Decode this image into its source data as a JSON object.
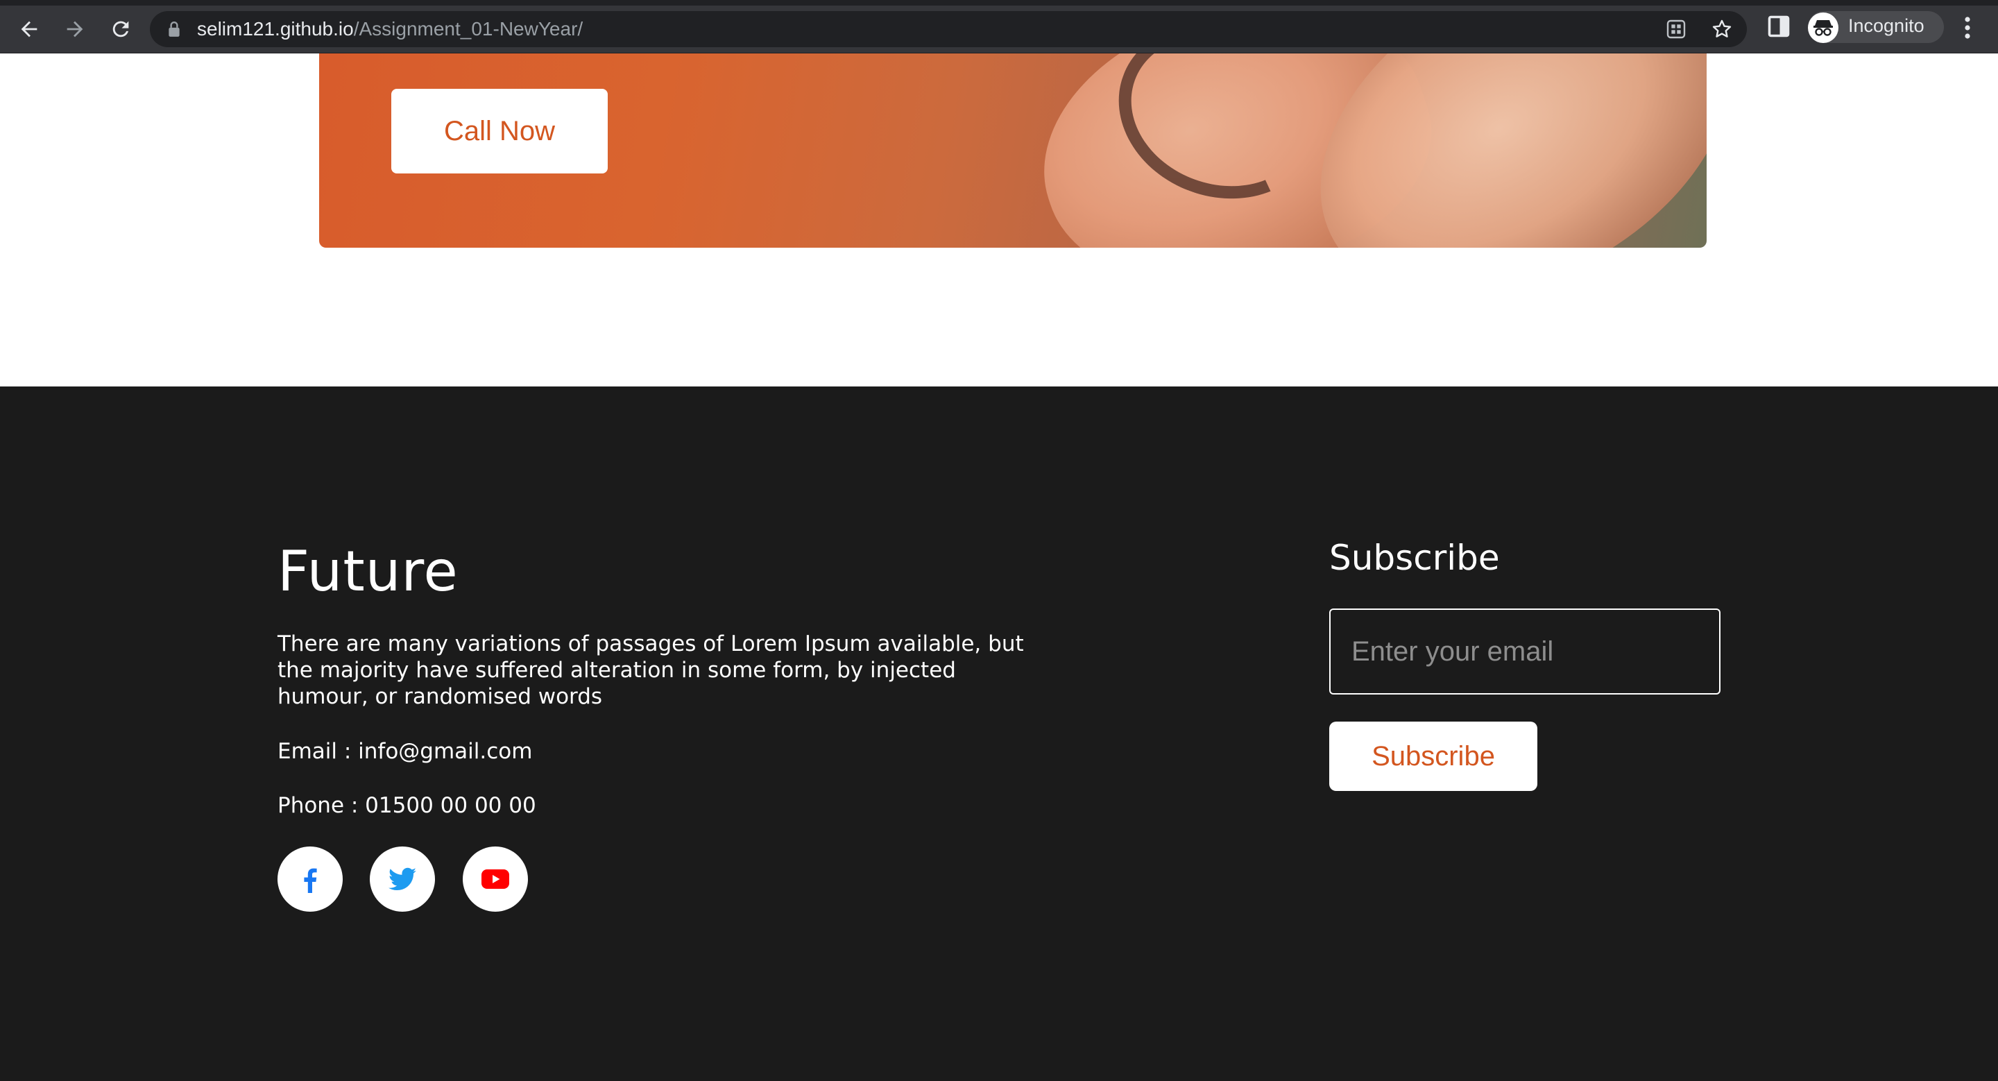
{
  "browser": {
    "url_host": "selim121.github.io",
    "url_path": "/Assignment_01-NewYear/",
    "profile_label": "Incognito",
    "icons": [
      "back-icon",
      "forward-icon",
      "reload-icon",
      "lock-icon",
      "extension-grid-icon",
      "bookmark-star-icon",
      "side-panel-icon",
      "incognito-icon",
      "menu-dots-icon"
    ]
  },
  "banner": {
    "cta_label": "Call Now"
  },
  "footer": {
    "brand": "Future",
    "description": "There are many variations of passages of Lorem Ipsum available, but the majority have suffered alteration in some form, by injected humour, or randomised words",
    "email_line": "Email : info@gmail.com",
    "phone_line": "Phone : 01500 00 00 00",
    "social": [
      "facebook-icon",
      "twitter-icon",
      "youtube-icon"
    ],
    "subscribe_title": "Subscribe",
    "email_placeholder": "Enter your email",
    "subscribe_button": "Subscribe"
  },
  "colors": {
    "accent": "#d3561f",
    "footer_bg": "#1b1b1b",
    "facebook": "#1877f2",
    "twitter": "#1d9bf0",
    "youtube": "#ff0000"
  }
}
